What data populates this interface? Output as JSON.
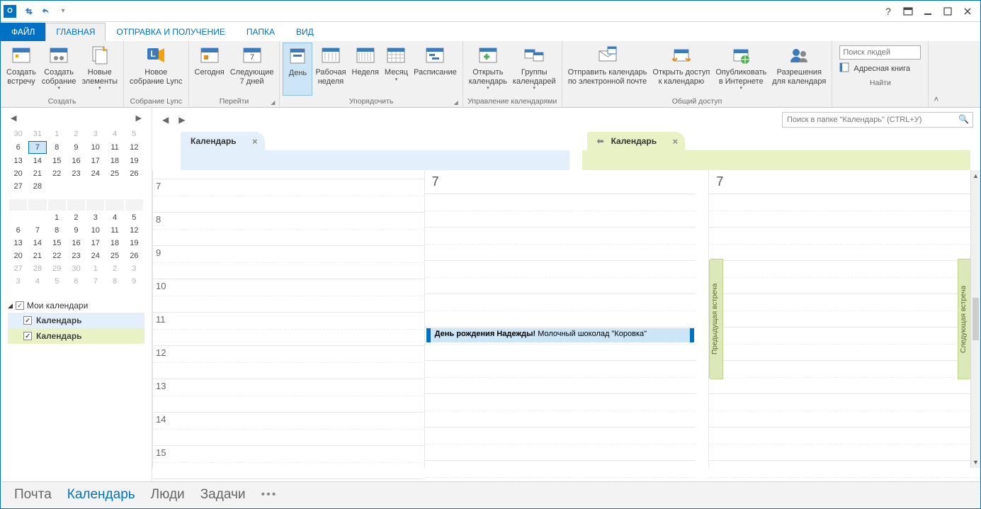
{
  "titlebar": {
    "help": "?"
  },
  "tabs": {
    "file": "ФАЙЛ",
    "home": "ГЛАВНАЯ",
    "sendrecv": "ОТПРАВКА И ПОЛУЧЕНИЕ",
    "folder": "ПАПКА",
    "view": "ВИД"
  },
  "ribbon": {
    "create": {
      "label": "Создать",
      "new_appt": "Создать\nвстречу",
      "new_meeting": "Создать\nсобрание",
      "new_items": "Новые\nэлементы"
    },
    "lync": {
      "label": "Собрание Lync",
      "btn": "Новое\nсобрание Lync"
    },
    "goto": {
      "label": "Перейти",
      "today": "Сегодня",
      "next7": "Следующие\n7 дней"
    },
    "arrange": {
      "label": "Упорядочить",
      "day": "День",
      "workweek": "Рабочая\nнеделя",
      "week": "Неделя",
      "month": "Месяц",
      "schedule": "Расписание"
    },
    "manage": {
      "label": "Управление календарями",
      "open_cal": "Открыть\nкалендарь",
      "cal_groups": "Группы\nкалендарей"
    },
    "share": {
      "label": "Общий доступ",
      "email_cal": "Отправить календарь\nпо электронной почте",
      "share_cal": "Открыть доступ\nк календарю",
      "publish": "Опубликовать\nв Интернете",
      "perms": "Разрешения\nдля календаря"
    },
    "find": {
      "label": "Найти",
      "placeholder": "Поиск людей",
      "addrbook": "Адресная книга"
    }
  },
  "sidebar": {
    "month1": {
      "rows": [
        [
          "30",
          "31",
          "1",
          "2",
          "3",
          "4",
          "5"
        ],
        [
          "6",
          "7",
          "8",
          "9",
          "10",
          "11",
          "12"
        ],
        [
          "13",
          "14",
          "15",
          "16",
          "17",
          "18",
          "19"
        ],
        [
          "20",
          "21",
          "22",
          "23",
          "24",
          "25",
          "26"
        ],
        [
          "27",
          "28",
          "",
          "",
          "",
          "",
          ""
        ]
      ],
      "dim_rows": [
        0
      ],
      "selected": [
        1,
        1
      ]
    },
    "month2": {
      "rows": [
        [
          "",
          "",
          "1",
          "2",
          "3",
          "4",
          "5"
        ],
        [
          "6",
          "7",
          "8",
          "9",
          "10",
          "11",
          "12"
        ],
        [
          "13",
          "14",
          "15",
          "16",
          "17",
          "18",
          "19"
        ],
        [
          "20",
          "21",
          "22",
          "23",
          "24",
          "25",
          "26"
        ],
        [
          "27",
          "28",
          "29",
          "30",
          "1",
          "2",
          "3"
        ],
        [
          "3",
          "4",
          "5",
          "6",
          "7",
          "8",
          "9"
        ]
      ]
    },
    "mycals": "Мои календари",
    "cal1": "Календарь",
    "cal2": "Календарь"
  },
  "calendar": {
    "search_placeholder": "Поиск в папке \"Календарь\" (CTRL+У)",
    "tab1": "Календарь",
    "tab2": "Календарь",
    "day_num": "7",
    "hours": [
      "7",
      "8",
      "9",
      "10",
      "11",
      "12",
      "13",
      "14",
      "15"
    ],
    "event_title": "День рождения Надежды!",
    "event_body": " Молочный шоколад \"Коровка\"",
    "prev_meet": "Предыдущая встреча",
    "next_meet": "Следующая встреча"
  },
  "footer": {
    "mail": "Почта",
    "calendar": "Календарь",
    "people": "Люди",
    "tasks": "Задачи"
  }
}
